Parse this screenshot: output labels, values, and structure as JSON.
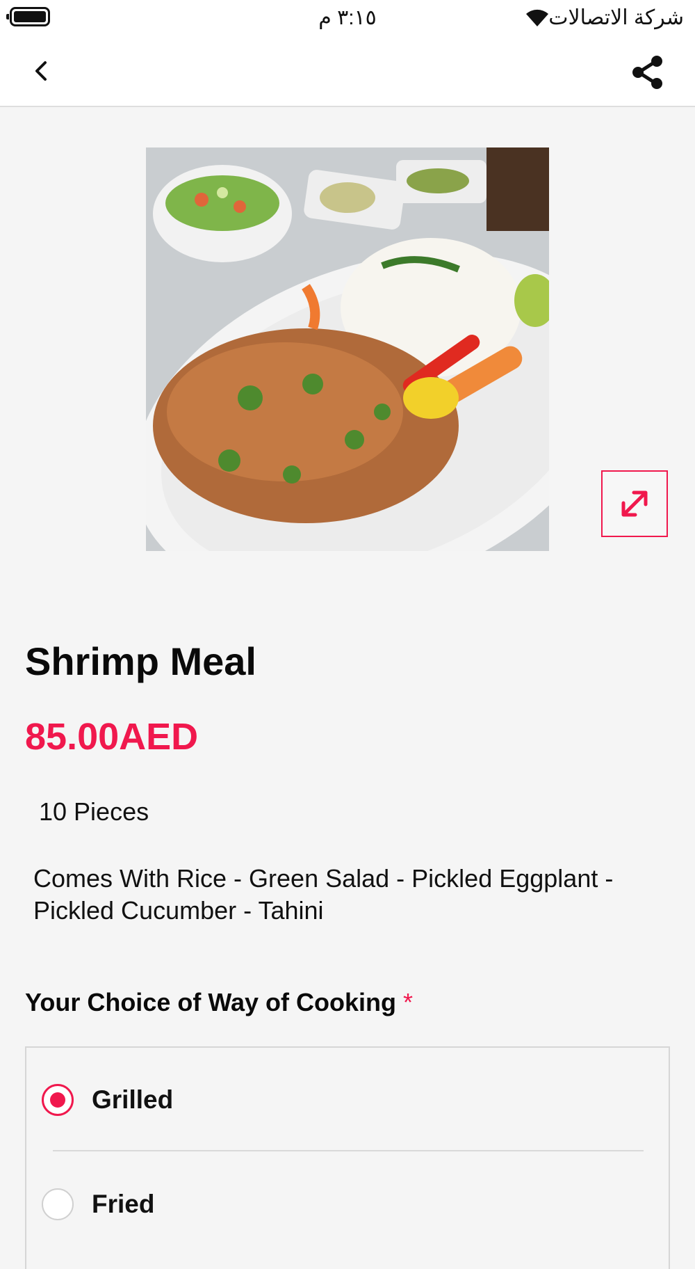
{
  "status_bar": {
    "carrier": "شركة الاتصالات",
    "time": "٣:١٥ م"
  },
  "app_bar": {
    "back_icon": "chevron-left-icon",
    "share_icon": "share-icon"
  },
  "product": {
    "image_alt": "Shrimp meal plate with rice, salad and vegetables",
    "expand_icon": "expand-icon",
    "title": "Shrimp Meal",
    "price": "85.00AED",
    "pieces": "10 Pieces",
    "description": "Comes With Rice - Green Salad - Pickled Eggplant - Pickled Cucumber - Tahini"
  },
  "choice": {
    "heading": "Your Choice of Way of Cooking",
    "required_mark": "*",
    "options": [
      {
        "label": "Grilled",
        "selected": true
      },
      {
        "label": "Fried",
        "selected": false
      }
    ]
  },
  "colors": {
    "accent": "#f0184d",
    "background": "#f5f5f5"
  }
}
